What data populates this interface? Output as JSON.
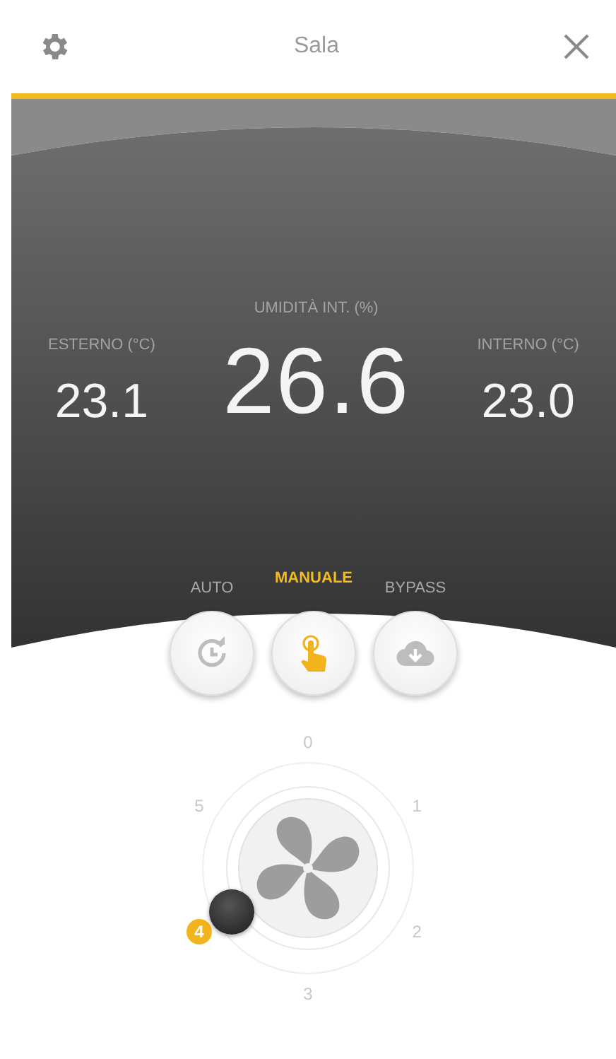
{
  "header": {
    "title": "Sala"
  },
  "readings": [
    {
      "label": "ESTERNO (°C)",
      "value": "23.1",
      "kind": "side"
    },
    {
      "label": "UMIDITÀ INT. (%)",
      "value": "26.6",
      "kind": "main"
    },
    {
      "label": "INTERNO (°C)",
      "value": "23.0",
      "kind": "side"
    }
  ],
  "modes": [
    {
      "label": "AUTO",
      "kind": "auto",
      "selected": false
    },
    {
      "label": "MANUALE",
      "kind": "manual",
      "selected": true
    },
    {
      "label": "BYPASS",
      "kind": "bypass",
      "selected": false
    }
  ],
  "fan_speeds": [
    {
      "label": "0",
      "selected": false
    },
    {
      "label": "1",
      "selected": false
    },
    {
      "label": "2",
      "selected": false
    },
    {
      "label": "3",
      "selected": false
    },
    {
      "label": "4",
      "selected": true
    },
    {
      "label": "5",
      "selected": false
    }
  ]
}
